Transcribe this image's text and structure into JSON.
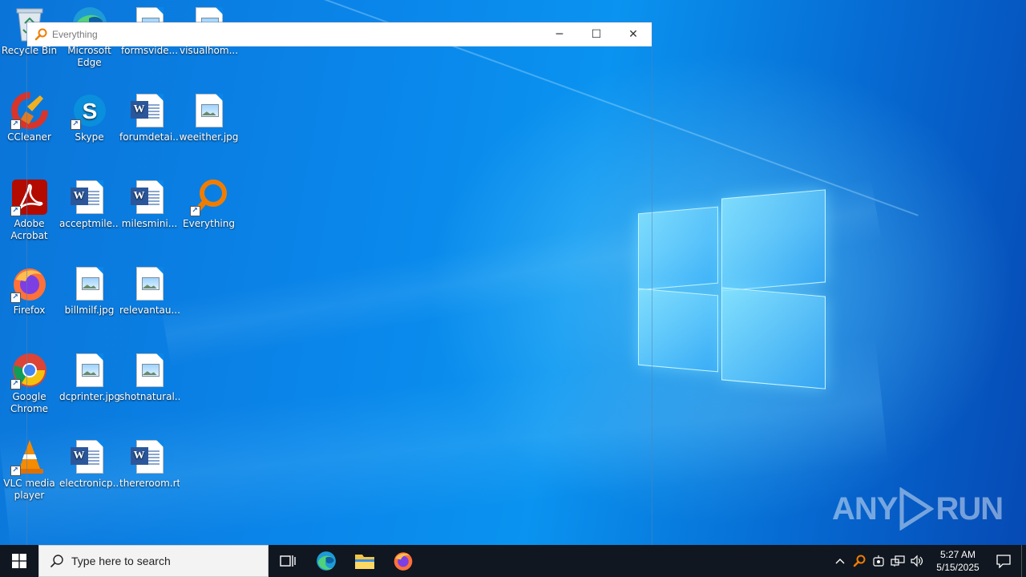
{
  "desktop": {
    "icons": [
      {
        "label": "Recycle Bin",
        "icon": "recycle-bin-icon"
      },
      {
        "label": "Microsoft Edge",
        "icon": "edge-icon"
      },
      {
        "label": "formsvide...",
        "icon": "image-file-icon"
      },
      {
        "label": "visualhom...",
        "icon": "image-file-icon"
      },
      {
        "label": "CCleaner",
        "icon": "ccleaner-icon"
      },
      {
        "label": "Skype",
        "icon": "skype-icon"
      },
      {
        "label": "forumdetai...",
        "icon": "word-doc-icon"
      },
      {
        "label": "weeither.jpg",
        "icon": "image-file-icon"
      },
      {
        "label": "Adobe Acrobat",
        "icon": "acrobat-icon"
      },
      {
        "label": "acceptmile...",
        "icon": "word-doc-icon"
      },
      {
        "label": "milesmini...",
        "icon": "word-doc-icon"
      },
      {
        "label": "Everything",
        "icon": "everything-icon"
      },
      {
        "label": "Firefox",
        "icon": "firefox-icon"
      },
      {
        "label": "billmilf.jpg",
        "icon": "image-file-icon"
      },
      {
        "label": "relevantau...",
        "icon": "image-file-icon"
      },
      {
        "label": "Google Chrome",
        "icon": "chrome-icon"
      },
      {
        "label": "dcprinter.jpg",
        "icon": "image-file-icon"
      },
      {
        "label": "shotnatural...",
        "icon": "image-file-icon"
      },
      {
        "label": "VLC media player",
        "icon": "vlc-icon"
      },
      {
        "label": "electronicp...",
        "icon": "word-doc-icon"
      },
      {
        "label": "thereroom.rtf",
        "icon": "word-doc-icon"
      }
    ]
  },
  "window": {
    "title": "Everything",
    "minimize": "─",
    "maximize": "☐",
    "close": "✕"
  },
  "taskbar": {
    "search_placeholder": "Type here to search",
    "time": "5:27 AM",
    "date": "5/15/2025"
  },
  "watermark": {
    "left": "ANY",
    "right": "RUN"
  }
}
